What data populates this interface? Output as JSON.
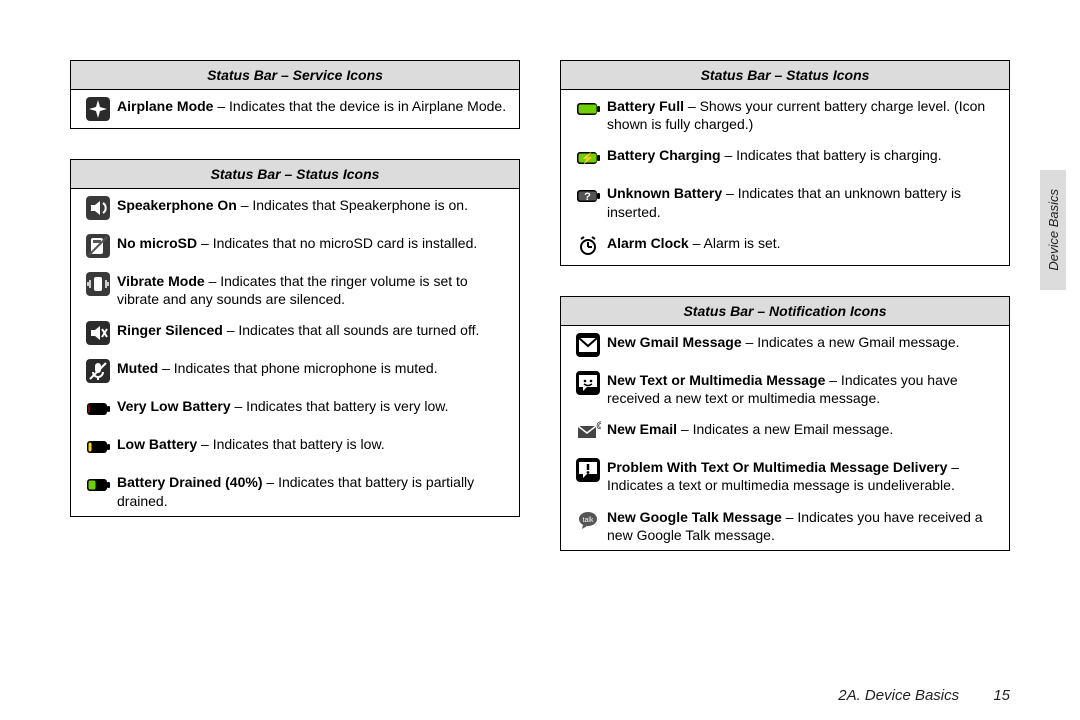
{
  "sideTab": "Device Basics",
  "footer": {
    "section": "2A. Device Basics",
    "page": "15"
  },
  "left": [
    {
      "header": "Status Bar – Service Icons",
      "rows": [
        {
          "icon": "airplane",
          "label": "Airplane Mode",
          "desc": " – Indicates that the device is in Airplane Mode."
        }
      ]
    },
    {
      "header": "Status Bar – Status Icons",
      "rows": [
        {
          "icon": "speakerphone",
          "label": "Speakerphone On",
          "desc": " – Indicates that Speakerphone is on."
        },
        {
          "icon": "no-sd",
          "label": "No microSD",
          "desc": " – Indicates that no microSD card is installed."
        },
        {
          "icon": "vibrate",
          "label": "Vibrate Mode ",
          "desc": " – Indicates that the ringer volume is set to vibrate and any sounds are silenced."
        },
        {
          "icon": "ringer-silenced",
          "label": "Ringer Silenced",
          "desc": " – Indicates that all sounds are turned off."
        },
        {
          "icon": "muted",
          "label": "Muted",
          "desc": " – Indicates that phone microphone is muted."
        },
        {
          "icon": "batt-verylow",
          "label": "Very Low Battery",
          "desc": " – Indicates that battery is very low."
        },
        {
          "icon": "batt-low",
          "label": "Low Battery",
          "desc": " – Indicates that battery is low."
        },
        {
          "icon": "batt-40",
          "label": "Battery Drained (40%)",
          "desc": " – Indicates that battery is partially drained."
        }
      ]
    }
  ],
  "right": [
    {
      "header": "Status Bar – Status Icons",
      "rows": [
        {
          "icon": "batt-full",
          "label": "Battery Full",
          "desc": " – Shows your current battery charge level. (Icon shown is fully charged.)"
        },
        {
          "icon": "batt-charging",
          "label": "Battery Charging",
          "desc": " – Indicates that battery is charging."
        },
        {
          "icon": "batt-unknown",
          "label": "Unknown Battery",
          "desc": " – Indicates that an unknown battery is inserted."
        },
        {
          "icon": "alarm",
          "label": "Alarm Clock",
          "desc": " – Alarm is set."
        }
      ]
    },
    {
      "header": "Status Bar – Notification Icons",
      "rows": [
        {
          "icon": "gmail",
          "label": "New Gmail Message",
          "desc": " – Indicates a new Gmail message."
        },
        {
          "icon": "sms",
          "label": "New Text or Multimedia Message",
          "desc": " – Indicates you have received a new text or multimedia message."
        },
        {
          "icon": "email",
          "label": "New Email",
          "desc": " – Indicates a new Email message."
        },
        {
          "icon": "sms-problem",
          "label": "Problem With Text Or Multimedia Message Delivery",
          "desc": " – Indicates a text or multimedia message is undeliverable."
        },
        {
          "icon": "talk",
          "label": "New Google Talk Message",
          "desc": " – Indicates you have received a new Google Talk message."
        }
      ]
    }
  ]
}
